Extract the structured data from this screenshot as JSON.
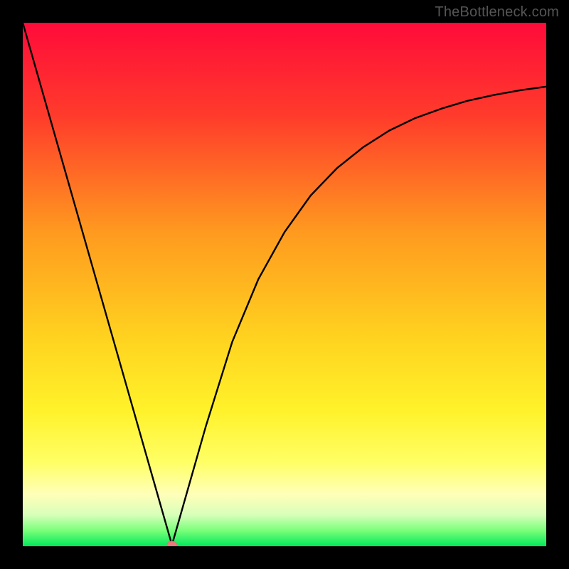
{
  "watermark": "TheBottleneck.com",
  "chart_data": {
    "type": "line",
    "title": "",
    "xlabel": "",
    "ylabel": "",
    "xlim": [
      0,
      1
    ],
    "ylim": [
      0,
      1
    ],
    "x": [
      0.0,
      0.05,
      0.1,
      0.15,
      0.2,
      0.24,
      0.26,
      0.28,
      0.285,
      0.29,
      0.3,
      0.32,
      0.35,
      0.4,
      0.45,
      0.5,
      0.55,
      0.6,
      0.65,
      0.7,
      0.75,
      0.8,
      0.85,
      0.9,
      0.95,
      1.0
    ],
    "values": [
      1.0,
      0.825,
      0.65,
      0.475,
      0.3,
      0.16,
      0.09,
      0.02,
      0.0025,
      0.02,
      0.055,
      0.125,
      0.23,
      0.39,
      0.51,
      0.6,
      0.67,
      0.722,
      0.762,
      0.794,
      0.818,
      0.836,
      0.851,
      0.862,
      0.871,
      0.878
    ],
    "minimum_marker": {
      "x": 0.285,
      "y": 0.003,
      "color": "#e77a7a"
    },
    "background_gradient": {
      "stops": [
        {
          "offset": "0%",
          "color": "#ff0b3a"
        },
        {
          "offset": "18%",
          "color": "#ff3c2b"
        },
        {
          "offset": "40%",
          "color": "#ff9a1f"
        },
        {
          "offset": "60%",
          "color": "#ffd21f"
        },
        {
          "offset": "74%",
          "color": "#fff22a"
        },
        {
          "offset": "84%",
          "color": "#ffff66"
        },
        {
          "offset": "90%",
          "color": "#ffffb8"
        },
        {
          "offset": "94%",
          "color": "#d8ffba"
        },
        {
          "offset": "97%",
          "color": "#7aff7a"
        },
        {
          "offset": "100%",
          "color": "#00e85a"
        }
      ]
    }
  }
}
